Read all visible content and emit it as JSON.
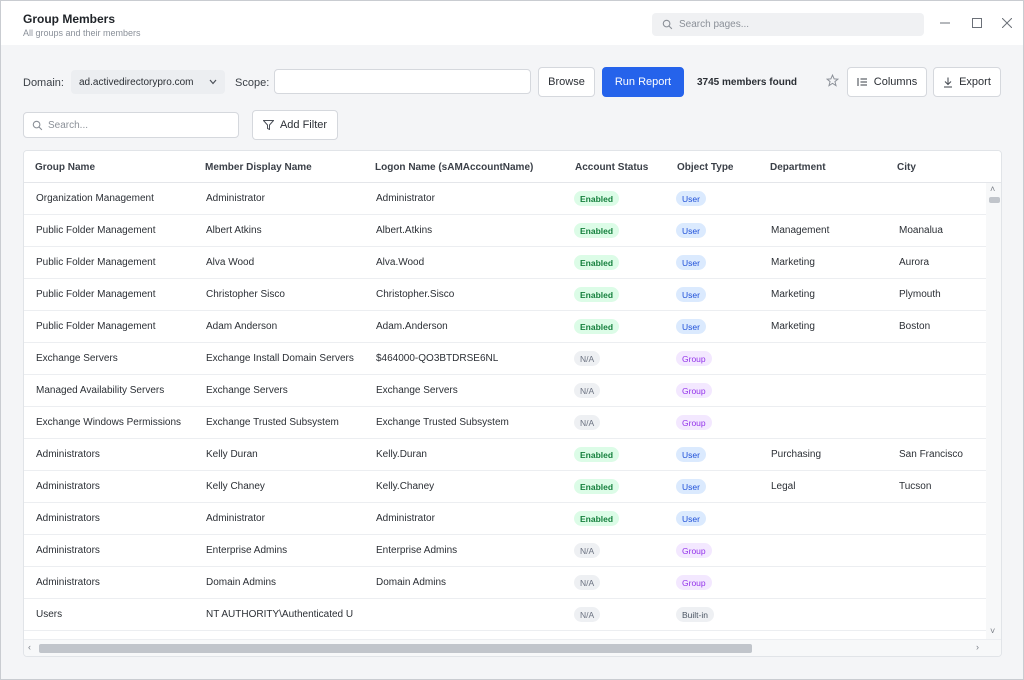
{
  "header": {
    "title": "Group Members",
    "subtitle": "All groups and their members",
    "search_placeholder": "Search pages..."
  },
  "toolbar": {
    "domain_label": "Domain:",
    "domain_value": "ad.activedirectorypro.com",
    "scope_label": "Scope:",
    "scope_value": "",
    "browse_label": "Browse",
    "run_label": "Run Report",
    "count_text": "3745 members found",
    "columns_label": "Columns",
    "export_label": "Export",
    "search_placeholder": "Search...",
    "add_filter_label": "Add Filter"
  },
  "table": {
    "columns": [
      "Group Name",
      "Member Display Name",
      "Logon Name (sAMAccountName)",
      "Account Status",
      "Object Type",
      "Department",
      "City"
    ],
    "rows": [
      {
        "group": "Organization Management",
        "member": "Administrator",
        "logon": "Administrator",
        "status": "Enabled",
        "type": "User",
        "dept": "",
        "city": ""
      },
      {
        "group": "Public Folder Management",
        "member": "Albert Atkins",
        "logon": "Albert.Atkins",
        "status": "Enabled",
        "type": "User",
        "dept": "Management",
        "city": "Moanalua"
      },
      {
        "group": "Public Folder Management",
        "member": "Alva Wood",
        "logon": "Alva.Wood",
        "status": "Enabled",
        "type": "User",
        "dept": "Marketing",
        "city": "Aurora"
      },
      {
        "group": "Public Folder Management",
        "member": "Christopher Sisco",
        "logon": "Christopher.Sisco",
        "status": "Enabled",
        "type": "User",
        "dept": "Marketing",
        "city": "Plymouth"
      },
      {
        "group": "Public Folder Management",
        "member": "Adam Anderson",
        "logon": "Adam.Anderson",
        "status": "Enabled",
        "type": "User",
        "dept": "Marketing",
        "city": "Boston"
      },
      {
        "group": "Exchange Servers",
        "member": "Exchange Install Domain Servers",
        "logon": "$464000-QO3BTDRSE6NL",
        "status": "N/A",
        "type": "Group",
        "dept": "",
        "city": ""
      },
      {
        "group": "Managed Availability Servers",
        "member": "Exchange Servers",
        "logon": "Exchange Servers",
        "status": "N/A",
        "type": "Group",
        "dept": "",
        "city": ""
      },
      {
        "group": "Exchange Windows Permissions",
        "member": "Exchange Trusted Subsystem",
        "logon": "Exchange Trusted Subsystem",
        "status": "N/A",
        "type": "Group",
        "dept": "",
        "city": ""
      },
      {
        "group": "Administrators",
        "member": "Kelly Duran",
        "logon": "Kelly.Duran",
        "status": "Enabled",
        "type": "User",
        "dept": "Purchasing",
        "city": "San Francisco"
      },
      {
        "group": "Administrators",
        "member": "Kelly Chaney",
        "logon": "Kelly.Chaney",
        "status": "Enabled",
        "type": "User",
        "dept": "Legal",
        "city": "Tucson"
      },
      {
        "group": "Administrators",
        "member": "Administrator",
        "logon": "Administrator",
        "status": "Enabled",
        "type": "User",
        "dept": "",
        "city": ""
      },
      {
        "group": "Administrators",
        "member": "Enterprise Admins",
        "logon": "Enterprise Admins",
        "status": "N/A",
        "type": "Group",
        "dept": "",
        "city": ""
      },
      {
        "group": "Administrators",
        "member": "Domain Admins",
        "logon": "Domain Admins",
        "status": "N/A",
        "type": "Group",
        "dept": "",
        "city": ""
      },
      {
        "group": "Users",
        "member": "NT AUTHORITY\\Authenticated U",
        "logon": "",
        "status": "N/A",
        "type": "Built-in",
        "dept": "",
        "city": ""
      }
    ]
  },
  "colors": {
    "primary": "#2563eb",
    "enabled_bg": "#dcfce7",
    "enabled_fg": "#15803d",
    "user_bg": "#dbeafe",
    "group_bg": "#f3e8ff"
  },
  "icons": {
    "search": "search-icon",
    "minimize": "minimize-icon",
    "maximize": "maximize-icon",
    "close": "close-icon",
    "star": "star-icon",
    "columns": "columns-icon",
    "export": "download-icon",
    "filter": "filter-icon",
    "dropdown": "chevron-down-icon"
  }
}
